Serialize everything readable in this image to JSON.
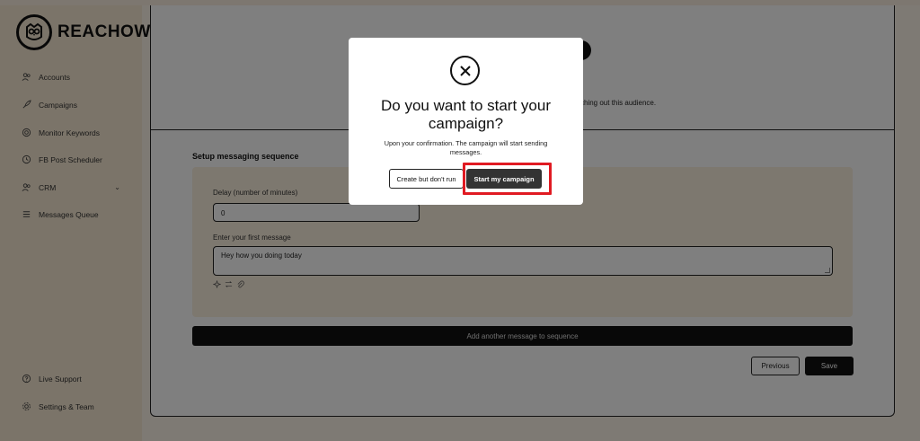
{
  "brand": {
    "name": "REACHOWL"
  },
  "sidebar": {
    "items": [
      {
        "label": "Accounts",
        "icon": "users-icon"
      },
      {
        "label": "Campaigns",
        "icon": "rocket-icon"
      },
      {
        "label": "Monitor Keywords",
        "icon": "target-icon"
      },
      {
        "label": "FB Post Scheduler",
        "icon": "clock-icon"
      },
      {
        "label": "CRM",
        "icon": "users-icon",
        "caret": "⌄"
      },
      {
        "label": "Messages Queue",
        "icon": "list-icon"
      }
    ],
    "bottom_items": [
      {
        "label": "Live Support",
        "icon": "help-icon"
      },
      {
        "label": "Settings & Team",
        "icon": "gear-icon"
      }
    ]
  },
  "main": {
    "audience_text": "ching out this audience.",
    "sequence": {
      "title": "Setup messaging sequence",
      "delay_label": "Delay (number of minutes)",
      "delay_value": "0",
      "message_label": "Enter your first message",
      "message_value": "Hey how you doing today"
    },
    "add_button": "Add another message to sequence",
    "previous_button": "Previous",
    "save_button": "Save"
  },
  "modal": {
    "title": "Do you want to start your campaign?",
    "description": "Upon your confirmation. The campaign will start sending messages.",
    "create_button": "Create but don't run",
    "start_button": "Start my campaign"
  },
  "colors": {
    "sidebar_bg": "#f7e9d2",
    "sequence_bg": "#fbf0de",
    "highlight": "#e01a22",
    "dark": "#111111"
  }
}
